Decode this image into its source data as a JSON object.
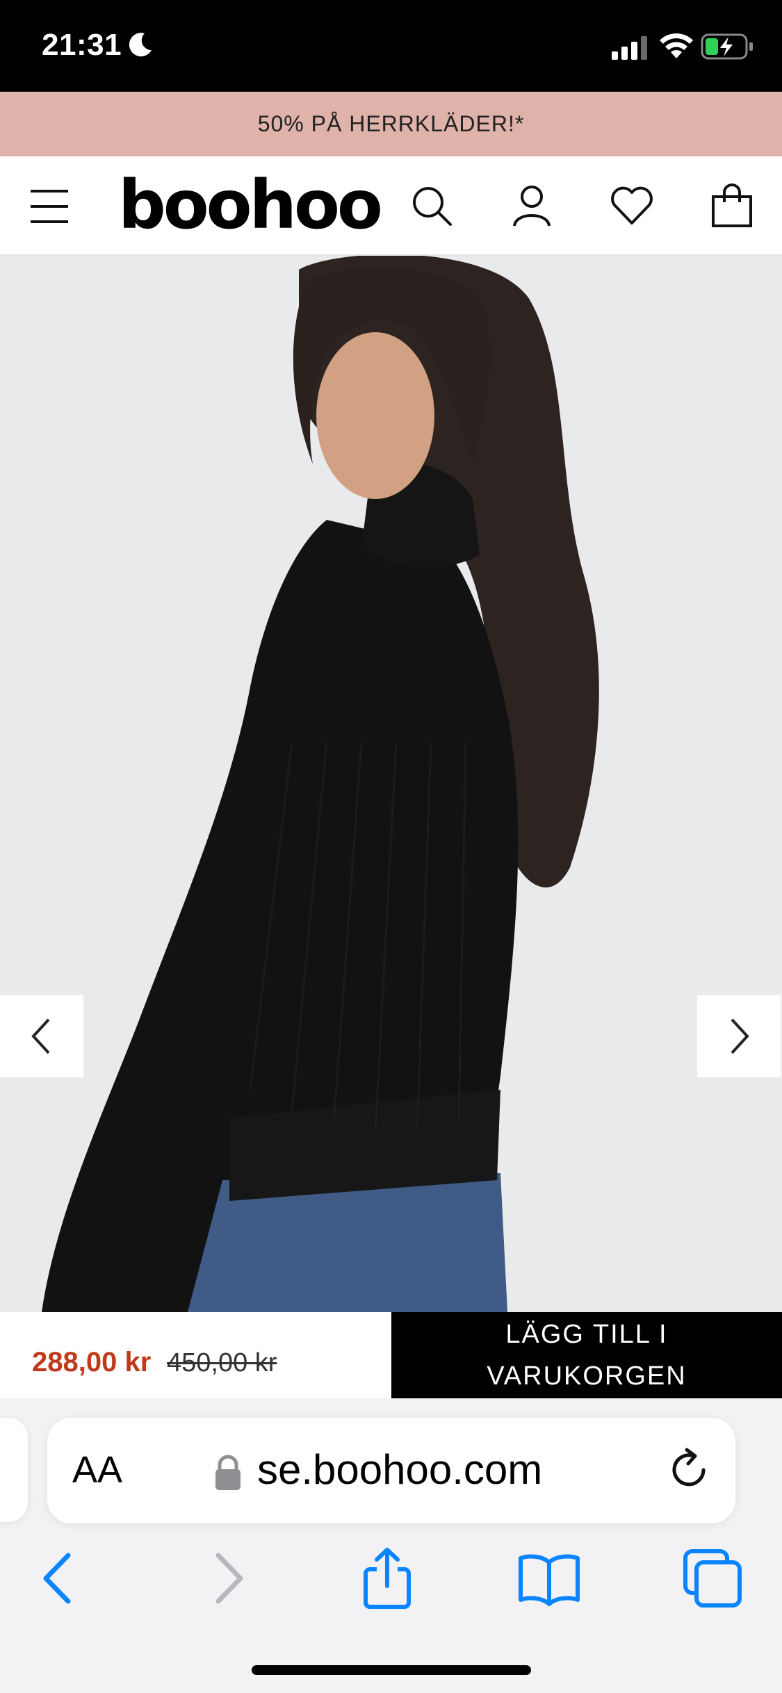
{
  "status_bar": {
    "time": "21:31"
  },
  "promo_banner": {
    "text": "50% PÅ HERRKLÄDER!*"
  },
  "header": {
    "logo": "boohoo",
    "icons": [
      "menu-icon",
      "search-icon",
      "account-icon",
      "heart-icon",
      "shopping-bag-icon"
    ]
  },
  "product": {
    "image_icons": [
      "chevron-left-icon",
      "chevron-right-icon"
    ]
  },
  "price_bar": {
    "sale_price": "288,00 kr",
    "original_price": "450,00 kr",
    "add_to_cart_line1": "LÄGG TILL I",
    "add_to_cart_line2": "VARUKORGEN"
  },
  "browser": {
    "text_size_label": "AA",
    "url": "se.boohoo.com",
    "toolbar_icons": [
      "back-icon",
      "forward-icon",
      "share-icon",
      "bookmarks-icon",
      "tabs-icon"
    ]
  },
  "colors": {
    "promo_bg": "#dfb2aa",
    "sale_price": "#c0391b",
    "safari_blue": "#0a84ff",
    "button_bg": "#000000"
  }
}
